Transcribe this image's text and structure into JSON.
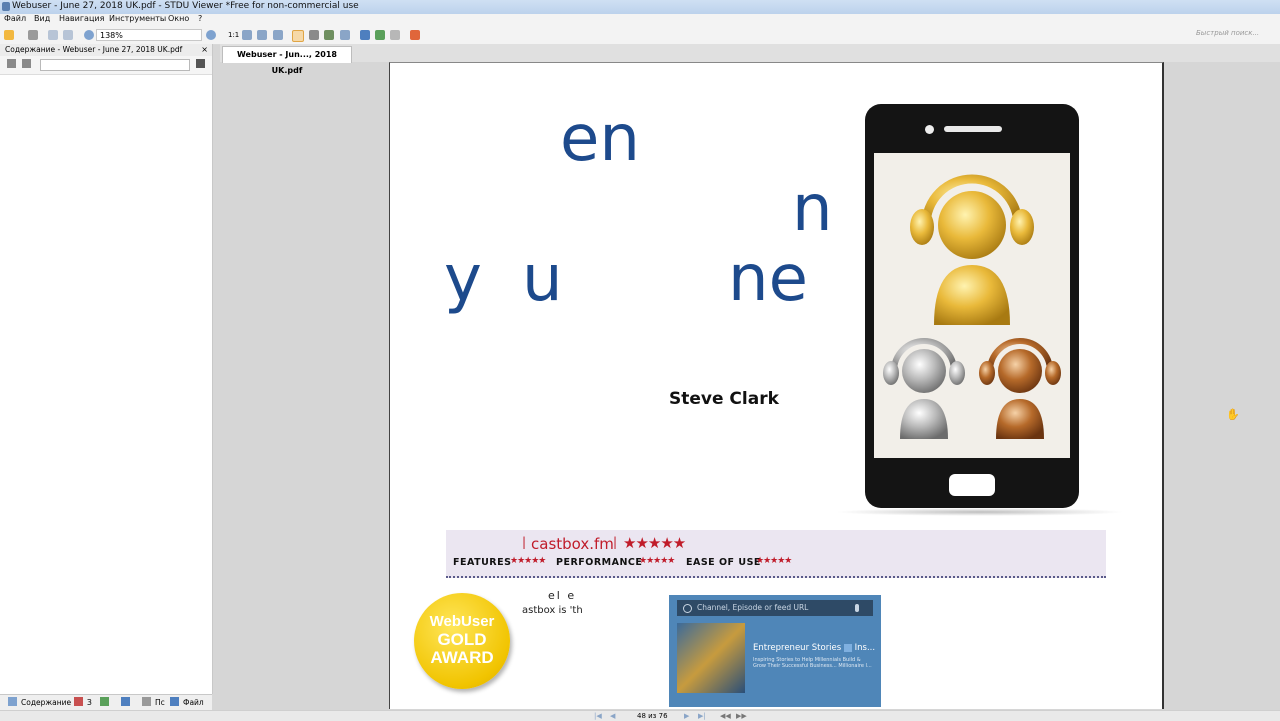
{
  "window": {
    "title": "Webuser - June 27, 2018  UK.pdf - STDU Viewer *Free for non-commercial use"
  },
  "menu": [
    "Файл",
    "Вид",
    "Навигация",
    "Инструменты",
    "Окно",
    "?"
  ],
  "toolbar": {
    "zoom": "138%",
    "page_num_btn": "1:1",
    "quick_search_placeholder": "Быстрый поиск..."
  },
  "left_panel": {
    "header": "Содержание - Webuser - June 27, 2018  UK.pdf",
    "tabs": [
      "Содержание",
      "З",
      "Пс",
      "Файл"
    ]
  },
  "doc_tab": "Webuser - Jun..., 2018  UK.pdf",
  "status": {
    "page": "48 из 76"
  },
  "page_content": {
    "heading_fragments": [
      "en",
      "n",
      "y",
      "u",
      "ne"
    ],
    "author": "Steve Clark",
    "rating": {
      "site": "castbox.fm",
      "stars": "★★★★★",
      "labels": [
        "FEATURES",
        "PERFORMANCE",
        "EASE OF USE"
      ],
      "sub_stars": "★★★★★"
    },
    "award": {
      "line1": "WebUser",
      "line2": "GOLD",
      "line3": "AWARD"
    },
    "body_fragment_1": "el e",
    "body_fragment_2": "astbox is 'th",
    "app_screenshot": {
      "search_placeholder": "Channel, Episode or feed URL",
      "title": "Entrepreneur Stories",
      "title_suffix": "Ins...",
      "subtitle": "Inspiring Stories to Help Millennials Build & Grow Their Successful Business... Millionaire I..."
    }
  },
  "colors": {
    "heading": "#1d4a8c",
    "brand_red": "#c01c2a",
    "gold": "#f1c400"
  }
}
